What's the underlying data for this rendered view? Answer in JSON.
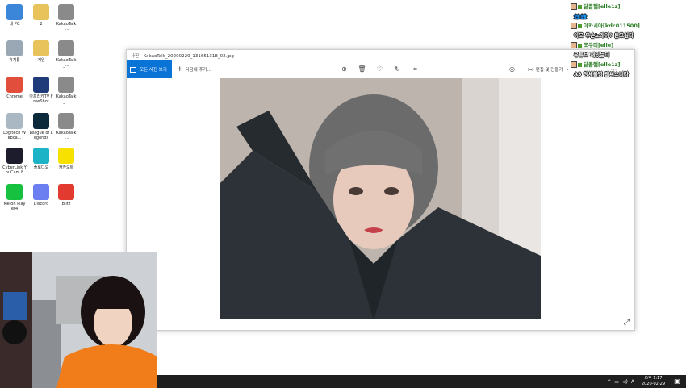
{
  "desktop_icons": [
    {
      "id": "mypc",
      "label": "내 PC",
      "color": "#3b86d8"
    },
    {
      "id": "folder2",
      "label": "2",
      "color": "#e8c25a"
    },
    {
      "id": "kakao1",
      "label": "KakaoTalk_...",
      "color": "#8a8a8a"
    },
    {
      "id": "recycle",
      "label": "휴지통",
      "color": "#9aa7b5"
    },
    {
      "id": "game",
      "label": "게임",
      "color": "#e8c25a"
    },
    {
      "id": "kakao2",
      "label": "KakaoTalk_...",
      "color": "#8a8a8a"
    },
    {
      "id": "chrome",
      "label": "Chrome",
      "color": "#e14f3c"
    },
    {
      "id": "afreeshot",
      "label": "아프리카TV FreeShot",
      "color": "#1f3b7a"
    },
    {
      "id": "kakao3",
      "label": "KakaoTalk_...",
      "color": "#8a8a8a"
    },
    {
      "id": "logitech",
      "label": "Logitech Webca...",
      "color": "#a9b8c2"
    },
    {
      "id": "lol",
      "label": "League of Legends",
      "color": "#0d2a3d"
    },
    {
      "id": "kakao4",
      "label": "KakaoTalk_...",
      "color": "#8a8a8a"
    },
    {
      "id": "youcam",
      "label": "CyberLink YouCam 8",
      "color": "#1c1c2c"
    },
    {
      "id": "studio",
      "label": "플로디오",
      "color": "#1bb3c5"
    },
    {
      "id": "kakaotalk",
      "label": "카카오톡",
      "color": "#f7e100"
    },
    {
      "id": "melon",
      "label": "Melon Player4",
      "color": "#16c140"
    },
    {
      "id": "discord",
      "label": "Discord",
      "color": "#6c7ff0"
    },
    {
      "id": "blitz",
      "label": "Blitz",
      "color": "#e33a2f"
    }
  ],
  "photos_window": {
    "title": "사진 - KakaoTalk_20200229_131651318_02.jpg",
    "all_photos_label": "모든 사진 보기",
    "add_to_label": "다음에 추가...",
    "edit_label": "편집 및 만들기",
    "icons": [
      "zoom-icon",
      "delete-icon",
      "heart-icon",
      "rotate-icon",
      "crop-icon"
    ],
    "accent": "#0a73d6"
  },
  "chat": [
    {
      "nick": "달콤햄[elle1z]",
      "msg": "👥👥"
    },
    {
      "nick": "아카시아[kdc011500]",
      "msg": "이모 무슨노래야? 듣고싶다"
    },
    {
      "nick": "쪼쿠미[elle]",
      "msg": "유튜브 재밌는디"
    },
    {
      "nick": "달콤햄[elle1z]",
      "msg": "A3 정체불명 웹써스니다"
    }
  ],
  "taskbar": {
    "time": "오후 1:17",
    "date": "2020-02-29",
    "ime": "A",
    "tray_icons": [
      "chevron-up-icon",
      "network-icon",
      "volume-icon"
    ]
  }
}
